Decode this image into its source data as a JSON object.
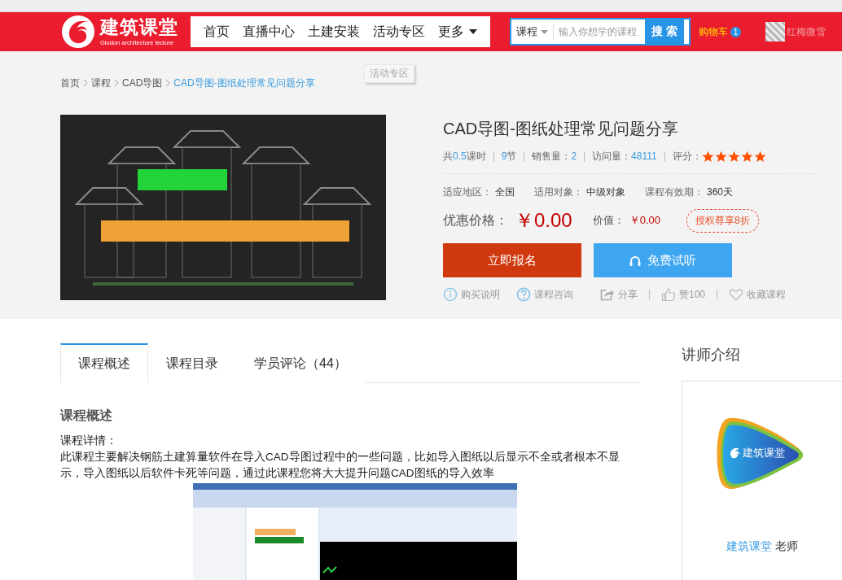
{
  "header": {
    "logo_title": "建筑课堂",
    "logo_subtitle": "Glodon architecture lecture",
    "nav": [
      {
        "label": "首页",
        "dropdown": false
      },
      {
        "label": "直播中心",
        "dropdown": false
      },
      {
        "label": "土建安装",
        "dropdown": false
      },
      {
        "label": "活动专区",
        "dropdown": false
      },
      {
        "label": "更多",
        "dropdown": true
      }
    ],
    "search": {
      "scope": "课程",
      "placeholder": "输入你想学的课程",
      "button": "搜 索"
    },
    "cart": {
      "label": "购物车",
      "count": "1"
    },
    "username": "红梅微雪"
  },
  "tooltip": "活动专区",
  "breadcrumb": [
    {
      "label": "首页",
      "current": false
    },
    {
      "label": "课程",
      "current": false
    },
    {
      "label": "CAD导图",
      "current": false
    },
    {
      "label": "CAD导图-图纸处理常见问题分享",
      "current": true
    }
  ],
  "course": {
    "title": "CAD导图-图纸处理常见问题分享",
    "stats": [
      {
        "prefix": "共",
        "number": "0.5",
        "suffix": "课时"
      },
      {
        "number": "9",
        "suffix": "节"
      },
      {
        "prefix": "销售量：",
        "number": "2"
      },
      {
        "prefix": "访问量：",
        "number": "48111"
      }
    ],
    "rating_label": "评分：",
    "stars": 5,
    "attributes": [
      {
        "label": "适应地区：",
        "value": "全国"
      },
      {
        "label": "适用对象：",
        "value": "中级对象"
      },
      {
        "label": "课程有效期：",
        "value": "360天"
      }
    ],
    "price_label": "优惠价格：",
    "price": "￥0.00",
    "value_label": "价值：",
    "value": "￥0.00",
    "promo": "授权尊享8折",
    "enroll_button": "立即报名",
    "trial_button": "免费试听",
    "actions": [
      {
        "kind": "info",
        "label": "购买说明"
      },
      {
        "kind": "help",
        "label": "课程咨询"
      },
      {
        "kind": "share",
        "label": "分享"
      },
      {
        "kind": "like",
        "label": "赞100"
      },
      {
        "kind": "favorite",
        "label": "收藏课程"
      }
    ]
  },
  "tabs": [
    {
      "label": "课程概述",
      "selected": true
    },
    {
      "label": "课程目录",
      "selected": false
    },
    {
      "label": "学员评论（44）",
      "selected": false
    }
  ],
  "overview": {
    "heading": "课程概述",
    "detail_label": "课程详情：",
    "description": "此课程主要解决钢筋土建算量软件在导入CAD导图过程中的一些问题，比如导入图纸以后显示不全或者根本不显示，导入图纸以后软件卡死等问题，通过此课程您将大大提升问题CAD图纸的导入效率"
  },
  "teacher": {
    "heading": "讲师介绍",
    "logo_text": "建筑课堂",
    "name": "建筑课堂",
    "suffix": "老师"
  }
}
